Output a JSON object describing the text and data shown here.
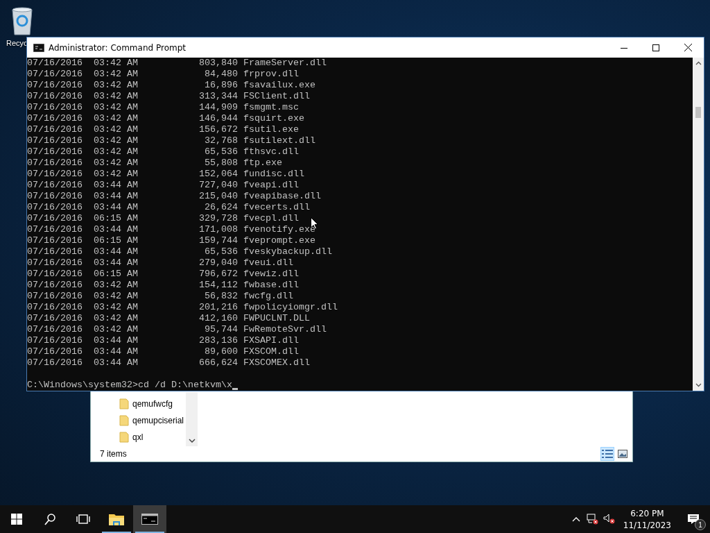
{
  "desktop": {
    "icons": [
      {
        "label": "Recyc"
      }
    ]
  },
  "explorer": {
    "items": [
      {
        "name": "qemufwcfg"
      },
      {
        "name": "qemupciserial"
      },
      {
        "name": "qxl"
      }
    ],
    "status": "7 items",
    "views": [
      {
        "kind": "details",
        "selected": true
      },
      {
        "kind": "tiles",
        "selected": false
      }
    ]
  },
  "console": {
    "title": "Administrator: Command Prompt",
    "lines": [
      "07/16/2016  03:42 AM           803,840 FrameServer.dll",
      "07/16/2016  03:42 AM            84,480 frprov.dll",
      "07/16/2016  03:42 AM            16,896 fsavailux.exe",
      "07/16/2016  03:42 AM           313,344 FSClient.dll",
      "07/16/2016  03:42 AM           144,909 fsmgmt.msc",
      "07/16/2016  03:42 AM           146,944 fsquirt.exe",
      "07/16/2016  03:42 AM           156,672 fsutil.exe",
      "07/16/2016  03:42 AM            32,768 fsutilext.dll",
      "07/16/2016  03:42 AM            65,536 fthsvc.dll",
      "07/16/2016  03:42 AM            55,808 ftp.exe",
      "07/16/2016  03:42 AM           152,064 fundisc.dll",
      "07/16/2016  03:44 AM           727,040 fveapi.dll",
      "07/16/2016  03:44 AM           215,040 fveapibase.dll",
      "07/16/2016  03:44 AM            26,624 fvecerts.dll",
      "07/16/2016  06:15 AM           329,728 fvecpl.dll",
      "07/16/2016  03:44 AM           171,008 fvenotify.exe",
      "07/16/2016  06:15 AM           159,744 fveprompt.exe",
      "07/16/2016  03:44 AM            65,536 fveskybackup.dll",
      "07/16/2016  03:44 AM           279,040 fveui.dll",
      "07/16/2016  06:15 AM           796,672 fvewiz.dll",
      "07/16/2016  03:42 AM           154,112 fwbase.dll",
      "07/16/2016  03:42 AM            56,832 fwcfg.dll",
      "07/16/2016  03:42 AM           201,216 fwpolicyiomgr.dll",
      "07/16/2016  03:42 AM           412,160 FWPUCLNT.DLL",
      "07/16/2016  03:42 AM            95,744 FwRemoteSvr.dll",
      "07/16/2016  03:44 AM           283,136 FXSAPI.dll",
      "07/16/2016  03:44 AM            89,600 FXSCOM.dll",
      "07/16/2016  03:44 AM           666,624 FXSCOMEX.dll"
    ],
    "prompt": "C:\\Windows\\system32>cd /d D:\\netkvm\\x"
  },
  "taskbar": {
    "apps": [
      {
        "kind": "explorer",
        "selected": false
      },
      {
        "kind": "console",
        "selected": true
      }
    ],
    "time": "6:20 PM",
    "date": "11/11/2023",
    "notifications": "1"
  }
}
